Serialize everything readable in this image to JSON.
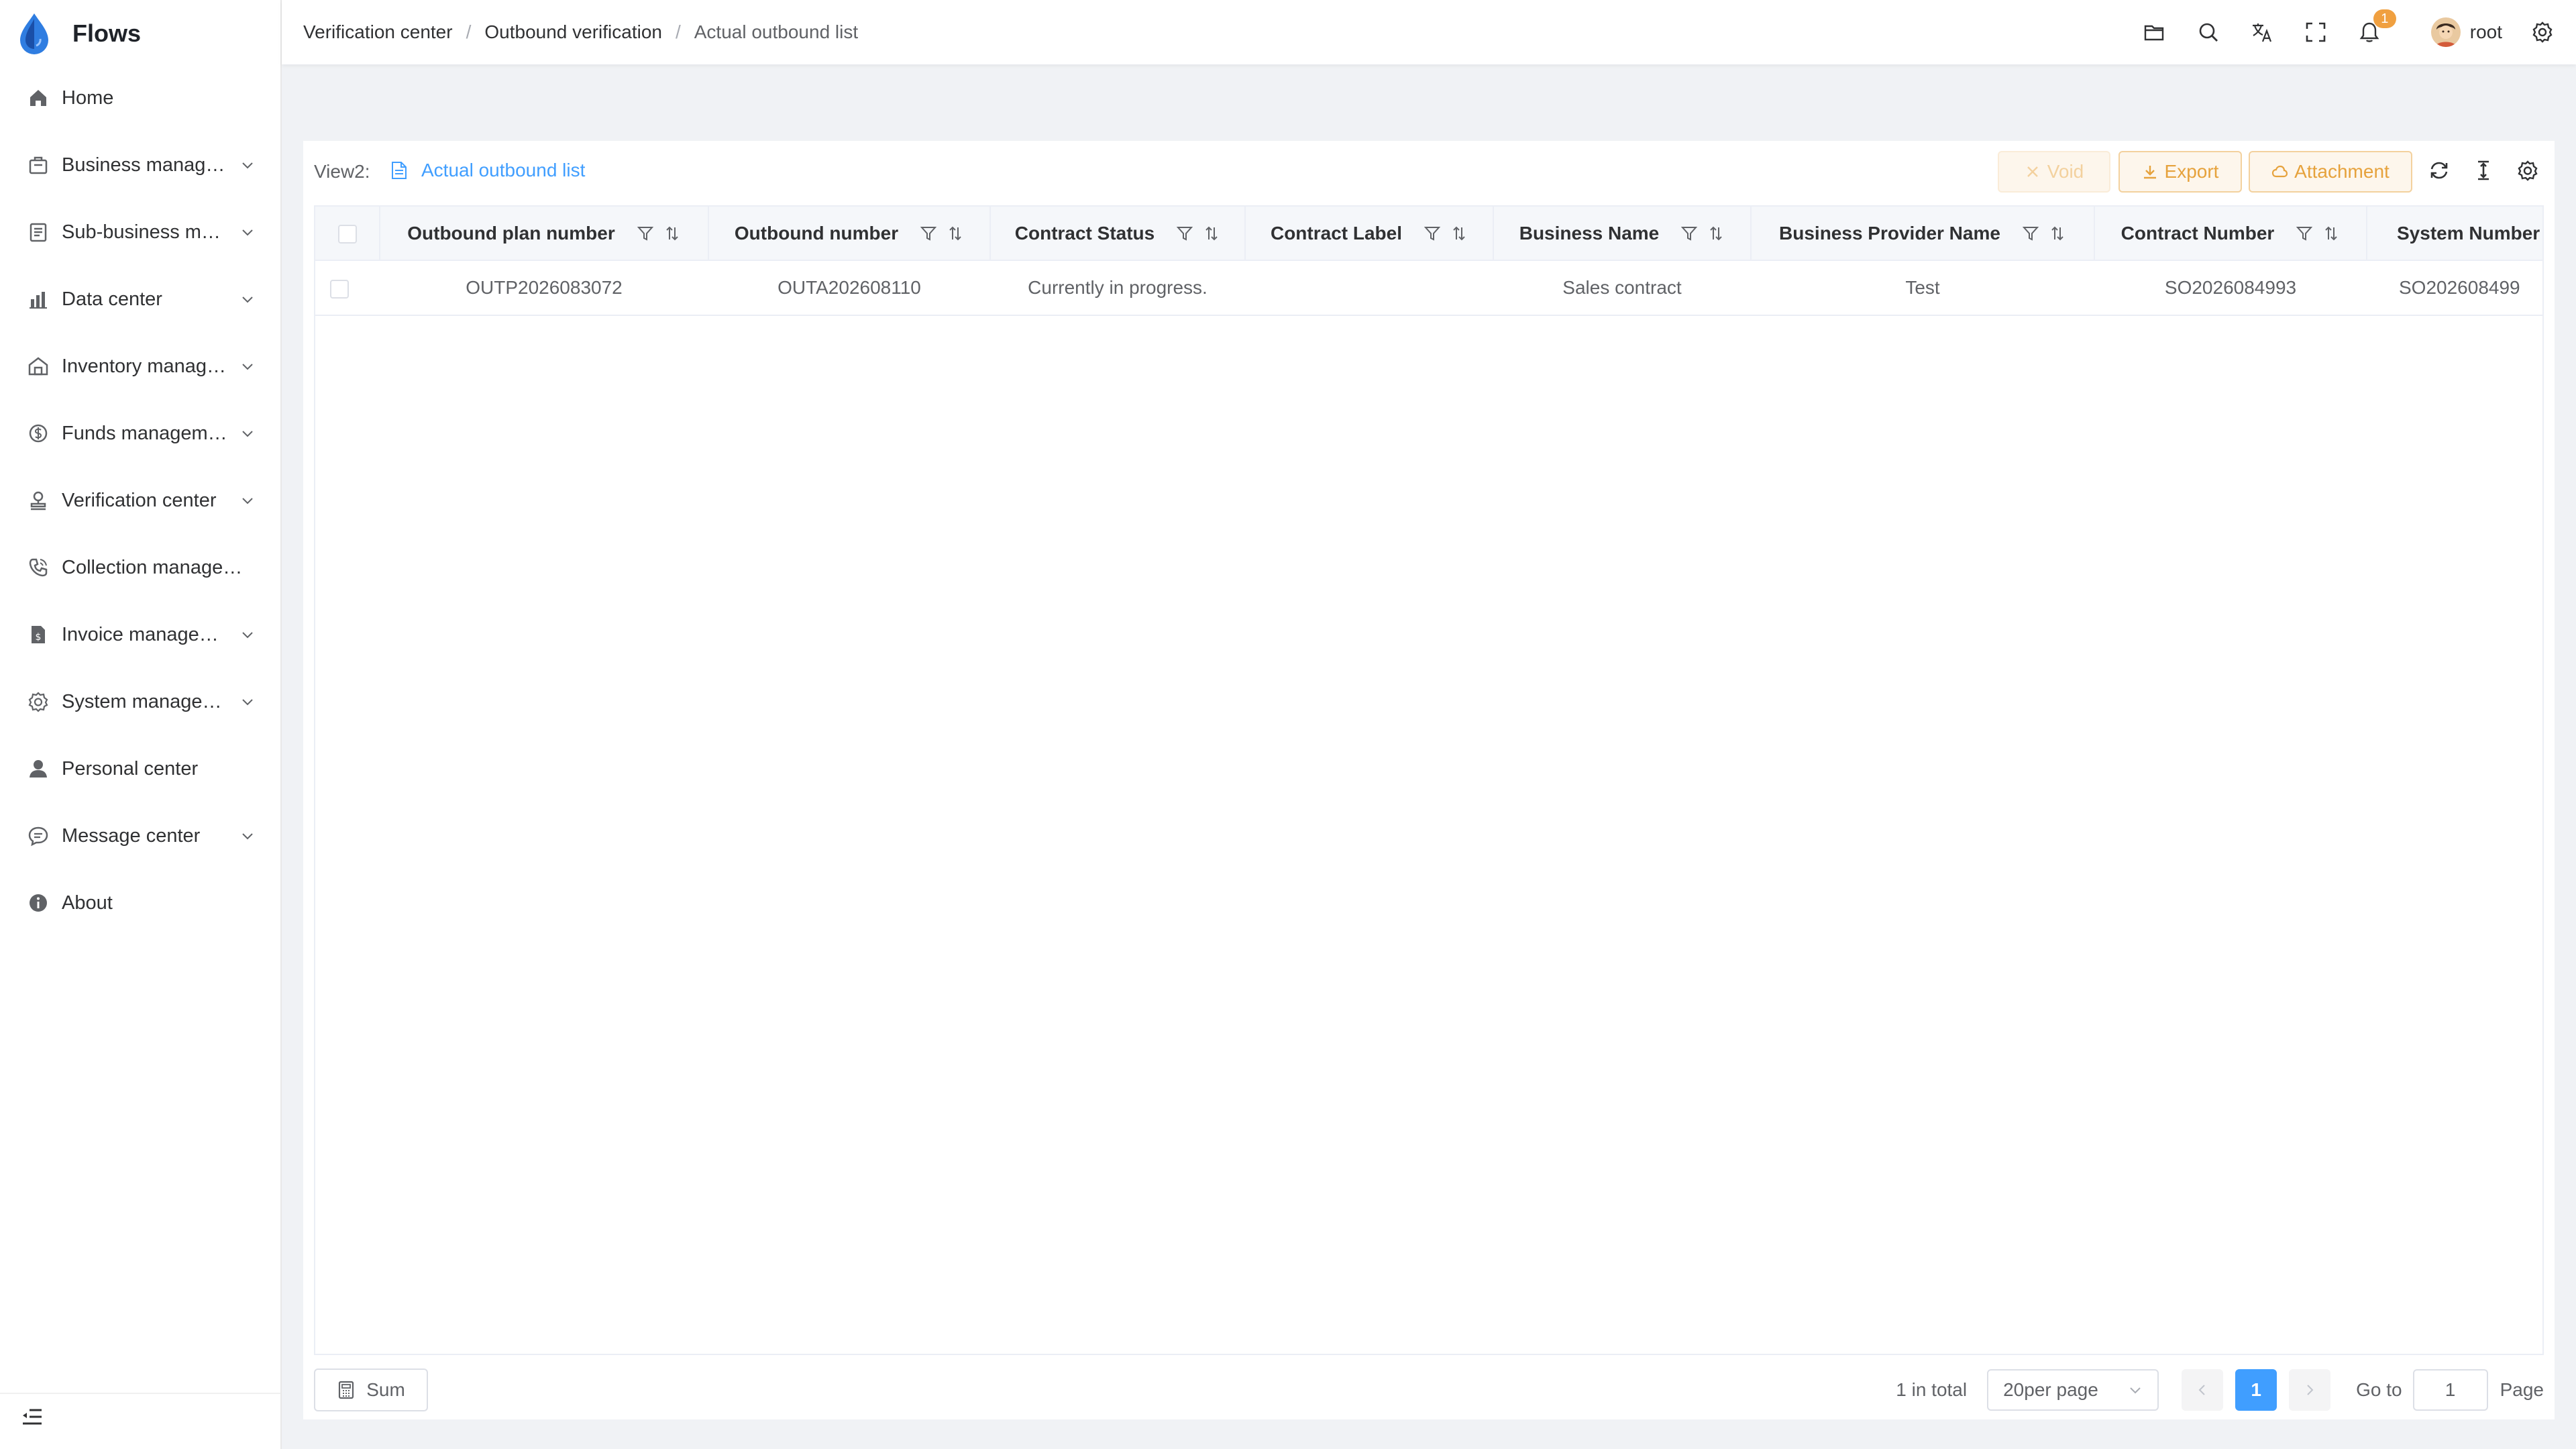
{
  "app": {
    "name": "Flows"
  },
  "sidebar": {
    "items": [
      {
        "label": "Home",
        "icon": "home-icon",
        "expandable": false
      },
      {
        "label": "Business manag…",
        "icon": "briefcase-icon",
        "expandable": true
      },
      {
        "label": "Sub-business m…",
        "icon": "document-list-icon",
        "expandable": true
      },
      {
        "label": "Data center",
        "icon": "bar-chart-icon",
        "expandable": true
      },
      {
        "label": "Inventory manag…",
        "icon": "warehouse-icon",
        "expandable": true
      },
      {
        "label": "Funds managem…",
        "icon": "dollar-circle-icon",
        "expandable": true
      },
      {
        "label": "Verification center",
        "icon": "stamp-icon",
        "expandable": true
      },
      {
        "label": "Collection managem…",
        "icon": "phone-icon",
        "expandable": false
      },
      {
        "label": "Invoice manage…",
        "icon": "invoice-icon",
        "expandable": true
      },
      {
        "label": "System manage…",
        "icon": "gear-icon",
        "expandable": true
      },
      {
        "label": "Personal center",
        "icon": "user-icon",
        "expandable": false
      },
      {
        "label": "Message center",
        "icon": "message-icon",
        "expandable": true
      },
      {
        "label": "About",
        "icon": "info-icon",
        "expandable": false
      }
    ]
  },
  "header": {
    "breadcrumb": [
      "Verification center",
      "Outbound verification",
      "Actual outbound list"
    ],
    "separator": "/",
    "notification_count": "1",
    "username": "root"
  },
  "toolbar": {
    "view_label": "View2:",
    "view_name": "Actual outbound list",
    "void_label": "Void",
    "export_label": "Export",
    "attachment_label": "Attachment"
  },
  "table": {
    "columns": [
      "Outbound plan number",
      "Outbound number",
      "Contract Status",
      "Contract Label",
      "Business Name",
      "Business Provider Name",
      "Contract Number",
      "System Number"
    ],
    "rows": [
      [
        "OUTP2026083072",
        "OUTA202608110",
        "Currently in progress.",
        "",
        "Sales contract",
        "Test",
        "SO2026084993",
        "SO202608499"
      ]
    ]
  },
  "footer": {
    "sum_label": "Sum",
    "total_text": "1 in total",
    "page_size": "20per page",
    "current_page": "1",
    "goto_label": "Go to",
    "goto_value": "1",
    "page_label": "Page"
  },
  "colors": {
    "primary": "#409eff",
    "warning": "#e6a23c",
    "badge": "#f0a040",
    "logo": "#2f7de1"
  }
}
